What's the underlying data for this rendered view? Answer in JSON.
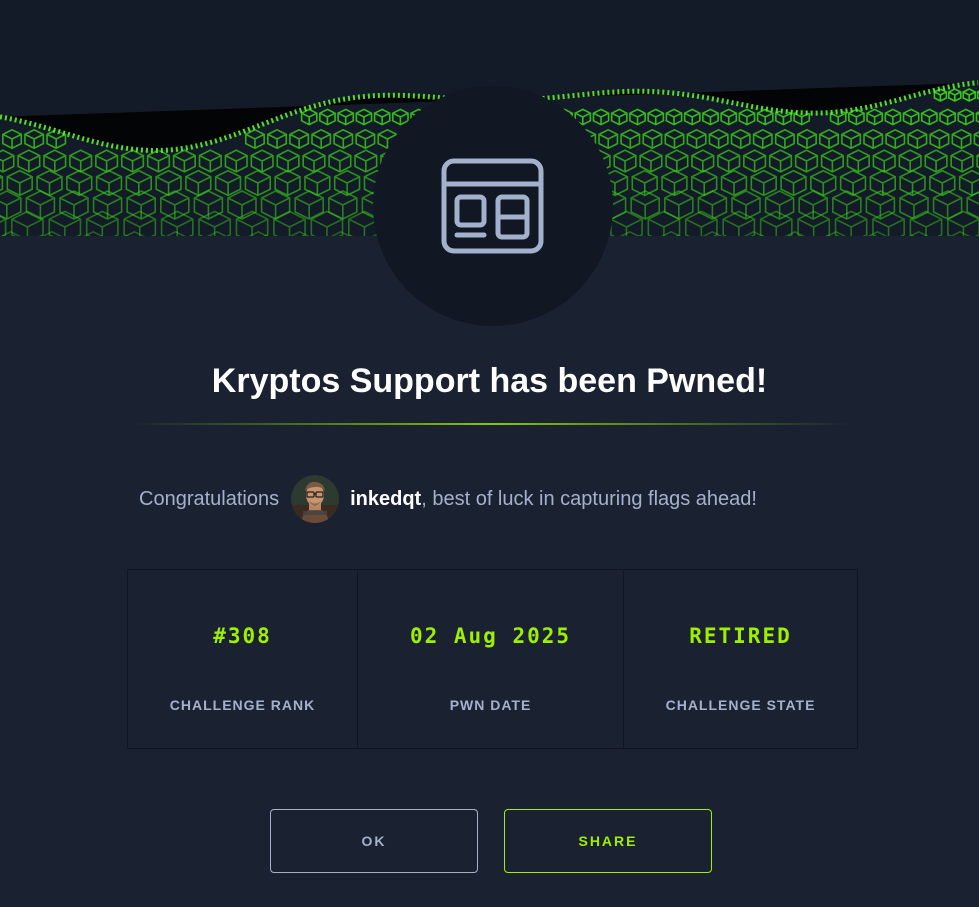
{
  "modal": {
    "title": "Kryptos Support has been Pwned!",
    "icon": "web-window-icon",
    "banner": "green-cube-wave"
  },
  "congrats": {
    "prefix": "Congratulations",
    "username": "inkedqt",
    "suffix": ", best of luck in capturing flags ahead!"
  },
  "stats": [
    {
      "value": "#308",
      "label": "CHALLENGE RANK"
    },
    {
      "value": "02 Aug 2025",
      "label": "PWN DATE"
    },
    {
      "value": "RETIRED",
      "label": "CHALLENGE STATE"
    }
  ],
  "buttons": {
    "ok_label": "OK",
    "share_label": "SHARE"
  },
  "colors": {
    "accent": "#9fef00",
    "background": "#1a2232",
    "muted_text": "#a4b1cd"
  }
}
